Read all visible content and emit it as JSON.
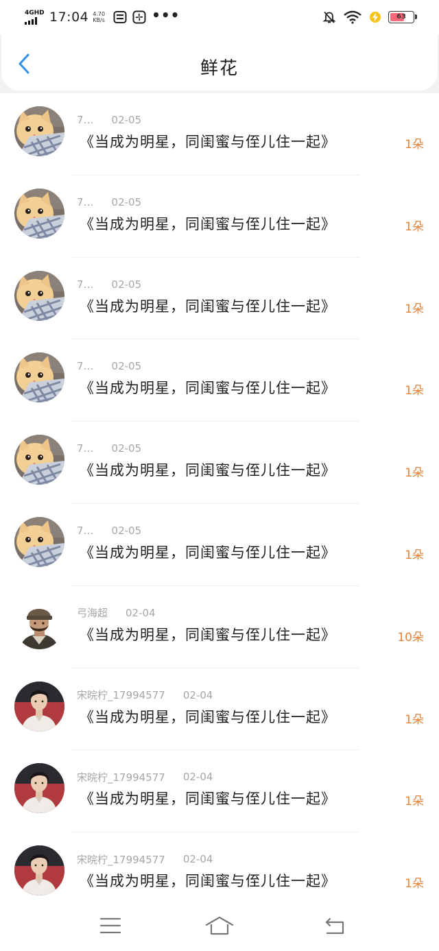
{
  "statusbar": {
    "network_type": "4GHD",
    "time": "17:04",
    "speed_value": "4.70",
    "speed_unit": "KB/s",
    "more": "•••",
    "battery_level": 63,
    "battery_label": "63",
    "icons": [
      "signal-icon",
      "sim-card-icon",
      "fan-icon",
      "mute-bell-icon",
      "wifi-icon",
      "charging-icon",
      "battery-icon"
    ]
  },
  "header": {
    "back_icon": "chevron-left-icon",
    "title": "鲜花"
  },
  "colors": {
    "accent_blue": "#2f8fe8",
    "count_orange": "#e8833a",
    "meta_gray": "#a6a6a6",
    "battery_red": "#ff6a7a"
  },
  "entries": [
    {
      "user": "7…",
      "date": "02-05",
      "book": "《当成为明星，同闺蜜与侄儿住一起》",
      "count": "1朵",
      "avatar": "cat-avatar"
    },
    {
      "user": "7…",
      "date": "02-05",
      "book": "《当成为明星，同闺蜜与侄儿住一起》",
      "count": "1朵",
      "avatar": "cat-avatar"
    },
    {
      "user": "7…",
      "date": "02-05",
      "book": "《当成为明星，同闺蜜与侄儿住一起》",
      "count": "1朵",
      "avatar": "cat-avatar"
    },
    {
      "user": "7…",
      "date": "02-05",
      "book": "《当成为明星，同闺蜜与侄儿住一起》",
      "count": "1朵",
      "avatar": "cat-avatar"
    },
    {
      "user": "7…",
      "date": "02-05",
      "book": "《当成为明星，同闺蜜与侄儿住一起》",
      "count": "1朵",
      "avatar": "cat-avatar"
    },
    {
      "user": "7…",
      "date": "02-05",
      "book": "《当成为明星，同闺蜜与侄儿住一起》",
      "count": "1朵",
      "avatar": "cat-avatar"
    },
    {
      "user": "弓海超",
      "date": "02-04",
      "book": "《当成为明星，同闺蜜与侄儿住一起》",
      "count": "10朵",
      "avatar": "soldier-avatar"
    },
    {
      "user": "宋晥柠_17994577",
      "date": "02-04",
      "book": "《当成为明星，同闺蜜与侄儿住一起》",
      "count": "1朵",
      "avatar": "man-avatar"
    },
    {
      "user": "宋晥柠_17994577",
      "date": "02-04",
      "book": "《当成为明星，同闺蜜与侄儿住一起》",
      "count": "1朵",
      "avatar": "man-avatar"
    },
    {
      "user": "宋晥柠_17994577",
      "date": "02-04",
      "book": "《当成为明星，同闺蜜与侄儿住一起》",
      "count": "1朵",
      "avatar": "man-avatar"
    }
  ],
  "navbar": {
    "icons": [
      "menu-icon",
      "home-icon",
      "back-arrow-icon"
    ]
  }
}
